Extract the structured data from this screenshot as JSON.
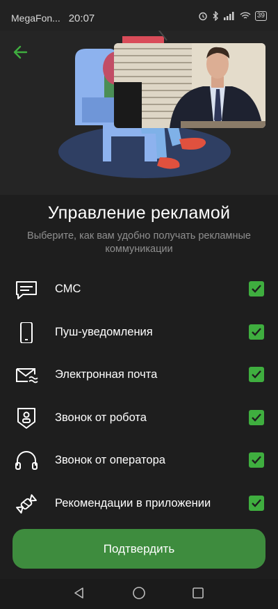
{
  "status_bar": {
    "carrier": "MegaFon...",
    "time": "20:07",
    "battery": "39"
  },
  "header": {
    "title": "Управление рекламой",
    "subtitle": "Выберите, как вам удобно получать рекламные коммуникации"
  },
  "options": [
    {
      "label": "СМС",
      "icon": "sms-message-icon",
      "checked": true
    },
    {
      "label": "Пуш-уведомления",
      "icon": "smartphone-icon",
      "checked": true
    },
    {
      "label": "Электронная почта",
      "icon": "email-icon",
      "checked": true
    },
    {
      "label": "Звонок от робота",
      "icon": "robot-shield-icon",
      "checked": true
    },
    {
      "label": "Звонок от оператора",
      "icon": "headset-icon",
      "checked": true
    },
    {
      "label": "Рекомендации в приложении",
      "icon": "candy-icon",
      "checked": true
    }
  ],
  "confirm_button": {
    "label": "Подтвердить"
  },
  "colors": {
    "accent": "#3e8c3e",
    "checkbox": "#3fae3f",
    "background": "#1e1e1e"
  }
}
